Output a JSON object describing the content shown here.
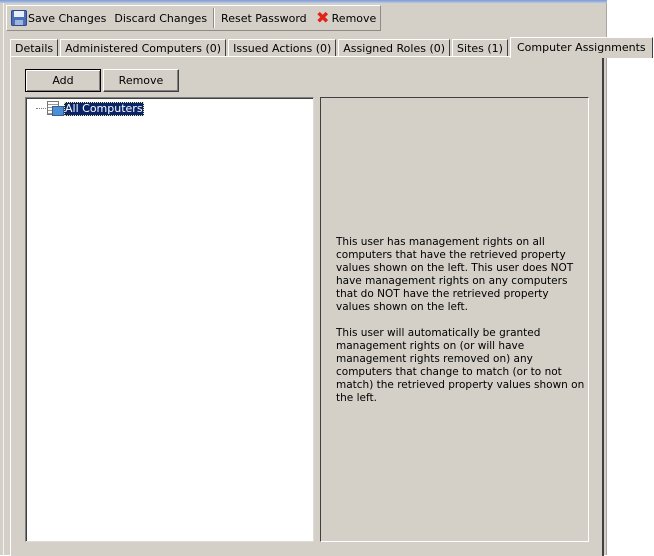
{
  "toolbar": {
    "save": {
      "label": "Save Changes",
      "icon": "floppy-disk-icon"
    },
    "discard": {
      "label": "Discard Changes"
    },
    "reset_password": {
      "label": "Reset Password"
    },
    "remove": {
      "label": "Remove",
      "icon": "red-x-icon"
    }
  },
  "tabs": [
    {
      "label": "Details",
      "active": false
    },
    {
      "label": "Administered Computers (0)",
      "active": false
    },
    {
      "label": "Issued Actions (0)",
      "active": false
    },
    {
      "label": "Assigned Roles (0)",
      "active": false
    },
    {
      "label": "Sites (1)",
      "active": false
    },
    {
      "label": "Computer Assignments",
      "active": true
    }
  ],
  "panel": {
    "add_label": "Add",
    "remove_label": "Remove",
    "tree": {
      "nodes": [
        {
          "label": "All Computers",
          "icon": "computer-group-icon",
          "selected": true
        }
      ]
    },
    "info": {
      "paragraph1": "This user has management rights on all computers that have the retrieved property values shown on the left. This user does NOT have management rights on any computers that do NOT have the retrieved property values shown on the left.",
      "paragraph2": "This user will automatically be granted management rights on (or will have management rights removed on) any computers that change to match (or to not match) the retrieved property values shown on the left."
    }
  },
  "colors": {
    "window_bg": "#d4d0c8",
    "selection_bg": "#0a246a",
    "remove_icon": "#e2231a"
  }
}
